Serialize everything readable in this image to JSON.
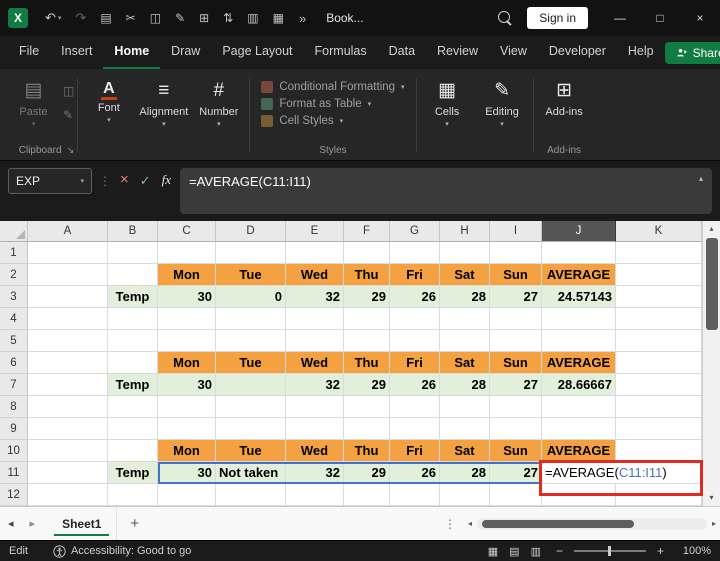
{
  "colors": {
    "excel_green": "#107C41",
    "header_fill": "#F4A142",
    "data_fill": "#E2EFDA",
    "ref_blue": "#4472C4",
    "annotation_red": "#E02B20",
    "selected_header": "#555555"
  },
  "icons": {
    "logo_x": "X",
    "undo": "↶",
    "redo": "↷",
    "overflow": "»",
    "chevron_down": "▾",
    "chevron_up": "▴",
    "tri_up": "▴",
    "tri_down": "▾",
    "tri_left": "◂",
    "tri_right": "▸",
    "kebab": "⋮",
    "close_x": "×",
    "check": "✓",
    "launcher": "↘"
  },
  "title_bar": {
    "workbook_name": "Book...",
    "sign_in_label": "Sign in",
    "qat_icons": [
      {
        "name": "clipboard",
        "glyph": "▤"
      },
      {
        "name": "cut",
        "glyph": "✂"
      },
      {
        "name": "copy",
        "glyph": "◫"
      },
      {
        "name": "format-painter",
        "glyph": "✎"
      },
      {
        "name": "borders",
        "glyph": "⊞"
      },
      {
        "name": "sort",
        "glyph": "⇅"
      },
      {
        "name": "table",
        "glyph": "▥"
      },
      {
        "name": "camera",
        "glyph": "▦"
      }
    ],
    "window_controls": [
      {
        "name": "minimize",
        "glyph": "—"
      },
      {
        "name": "maximize",
        "glyph": "□"
      },
      {
        "name": "close",
        "glyph": "×"
      }
    ]
  },
  "ribbon": {
    "tabs": [
      "File",
      "Insert",
      "Home",
      "Draw",
      "Page Layout",
      "Formulas",
      "Data",
      "Review",
      "View",
      "Developer",
      "Help"
    ],
    "active_tab": "Home",
    "share_label": "Share",
    "paste_label": "Paste",
    "clipboard_group_label": "Clipboard",
    "font_label": "Font",
    "alignment_label": "Alignment",
    "number_label": "Number",
    "styles_items": [
      "Conditional Formatting",
      "Format as Table",
      "Cell Styles"
    ],
    "styles_group_label": "Styles",
    "cells_label": "Cells",
    "editing_label": "Editing",
    "addins_label": "Add-ins",
    "addins_group_label": "Add-ins"
  },
  "ribbon_icons": {
    "paste": "▤",
    "copy": "◫",
    "format_painter": "✎",
    "font": "A",
    "alignment": "≡",
    "number": "#",
    "cells": "▦",
    "editing": "✎",
    "addins": "⊞"
  },
  "formula_bar": {
    "name_box": "EXP",
    "fx_label": "fx",
    "formula": "=AVERAGE(C11:I11)"
  },
  "grid": {
    "column_headers": [
      "A",
      "B",
      "C",
      "D",
      "E",
      "F",
      "G",
      "H",
      "I",
      "J",
      "K"
    ],
    "selected_column": "J",
    "num_rows": 12,
    "day_headers": [
      "Mon",
      "Tue",
      "Wed",
      "Thu",
      "Fri",
      "Sat",
      "Sun"
    ],
    "average_header": "AVERAGE",
    "header_rows": [
      2,
      6,
      10
    ],
    "data_rows": [
      {
        "row": 3,
        "label": "Temp",
        "values": [
          "30",
          "0",
          "32",
          "29",
          "26",
          "28",
          "27"
        ],
        "average": "24.57143"
      },
      {
        "row": 7,
        "label": "Temp",
        "values": [
          "30",
          "",
          "32",
          "29",
          "26",
          "28",
          "27"
        ],
        "average": "28.66667"
      },
      {
        "row": 11,
        "label": "Temp",
        "values": [
          "30",
          "Not taken",
          "32",
          "29",
          "26",
          "28",
          "27"
        ],
        "average": null
      }
    ],
    "edit_cell": {
      "row": 11,
      "col": "J",
      "prefix": "=AVERAGE(",
      "ref": "C11:I11",
      "suffix": ")"
    },
    "referenced_range": {
      "row": 11,
      "from_col": "C",
      "to_col": "I"
    }
  },
  "sheet_bar": {
    "tabs": [
      "Sheet1"
    ],
    "active_tab": "Sheet1",
    "add_label": "+"
  },
  "status_bar": {
    "mode": "Edit",
    "accessibility": "Accessibility: Good to go",
    "view_icons": [
      {
        "name": "normal-view",
        "glyph": "▦"
      },
      {
        "name": "page-layout-view",
        "glyph": "▤"
      },
      {
        "name": "page-break-view",
        "glyph": "▥"
      }
    ],
    "zoom_out_label": "−",
    "zoom_in_label": "+",
    "zoom_level": "100%"
  }
}
